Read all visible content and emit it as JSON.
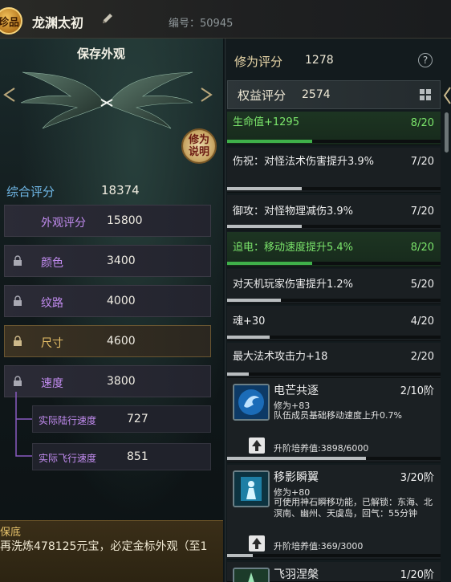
{
  "header": {
    "rarity_badge": "珍品",
    "char_name": "龙渊太初",
    "id_text": "编号：50945"
  },
  "left": {
    "save_look": "保存外观",
    "help_seal": "修为说明",
    "total_score_label": "综合评分",
    "total_score_value": "18374",
    "stats": [
      {
        "label": "外观评分",
        "value": "15800",
        "locked": false
      },
      {
        "label": "颜色",
        "value": "3400",
        "locked": true
      },
      {
        "label": "纹路",
        "value": "4000",
        "locked": true
      },
      {
        "label": "尺寸",
        "value": "4600",
        "locked": true
      },
      {
        "label": "速度",
        "value": "3800",
        "locked": true
      }
    ],
    "sub_stats": [
      {
        "label": "实际陆行速度",
        "value": "727"
      },
      {
        "label": "实际飞行速度",
        "value": "851"
      }
    ],
    "footer_title": "保底",
    "footer_text": "再洗炼478125元宝，必定金标外观（至1"
  },
  "right": {
    "cultivation_label": "修为评分",
    "cultivation_value": "1278",
    "help_icon": "?",
    "rights_label": "权益评分",
    "rights_value": "2574",
    "attributes": [
      {
        "text": "生命值+1295",
        "count": "8/20",
        "progress": 0.4,
        "green": true
      },
      {
        "text": "伤祝：对怪法术伤害提升3.9%",
        "count": "7/20",
        "progress": 0.35,
        "green": false
      },
      {
        "text": "御攻：对怪物理减伤3.9%",
        "count": "7/20",
        "progress": 0.35,
        "green": false
      },
      {
        "text": "追电：移动速度提升5.4%",
        "count": "8/20",
        "progress": 0.4,
        "green": true
      },
      {
        "text": "对天机玩家伤害提升1.2%",
        "count": "5/20",
        "progress": 0.25,
        "green": false
      },
      {
        "text": "魂+30",
        "count": "4/20",
        "progress": 0.2,
        "green": false
      },
      {
        "text": "最大法术攻击力+18",
        "count": "2/20",
        "progress": 0.1,
        "green": false
      }
    ],
    "skills": [
      {
        "name": "电芒共逐",
        "stage": "2/10阶",
        "gain": "修为+83",
        "desc": "队伍成员基础移动速度上升0.7%",
        "upgrade": "升阶培养值:3898/6000",
        "progress": 0.65
      },
      {
        "name": "移影瞬翼",
        "stage": "3/20阶",
        "gain": "修为+80",
        "desc": "可使用神石瞬移功能，已解锁：东海、北溟南、幽州、天虞岛，回气：55分钟",
        "upgrade": "升阶培养值:369/3000",
        "progress": 0.12
      },
      {
        "name": "飞羽涅槃",
        "stage": "1/20阶"
      }
    ]
  },
  "colors": {
    "accent_gold": "#e9c168",
    "stat_purple": "#c28cf0",
    "score_blue": "#6fb7e6",
    "attr_green": "#7be56b"
  }
}
